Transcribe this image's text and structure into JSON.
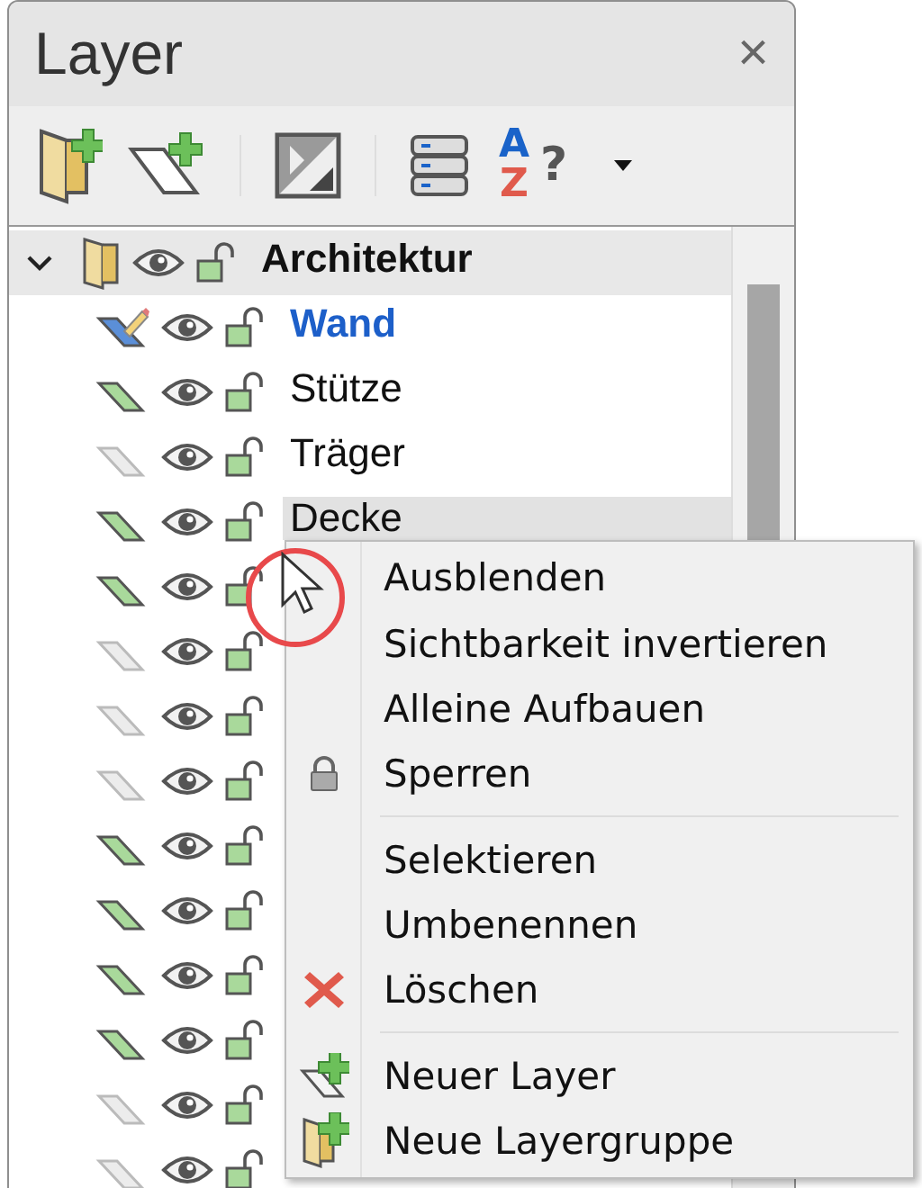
{
  "panel": {
    "title": "Layer",
    "close": "×"
  },
  "toolbar": {
    "sort_letters": [
      "A",
      "Z"
    ],
    "sort_mark": "?"
  },
  "groups": [
    {
      "name": "Architektur",
      "expanded": true,
      "layers": [
        {
          "name": "Wand",
          "color": "#5b8fd8",
          "selected": true
        },
        {
          "name": "Stütze",
          "color": "#a9d99b",
          "selected": false
        },
        {
          "name": "Träger",
          "color": "#ececec",
          "selected": false
        },
        {
          "name": "Decke",
          "color": "#a9d99b",
          "selected": false,
          "hovered": true
        },
        {
          "color": "#a9d99b",
          "selected": false
        },
        {
          "color": "#ececec",
          "selected": false
        },
        {
          "color": "#ececec",
          "selected": false
        },
        {
          "color": "#ececec",
          "selected": false
        },
        {
          "color": "#a9d99b",
          "selected": false
        },
        {
          "color": "#a9d99b",
          "selected": false
        },
        {
          "color": "#a9d99b",
          "selected": false
        },
        {
          "color": "#a9d99b",
          "selected": false
        },
        {
          "color": "#ececec",
          "selected": false
        },
        {
          "color": "#ececec",
          "selected": false
        }
      ]
    }
  ],
  "context_menu": {
    "items": [
      {
        "kind": "command",
        "label": "Ausblenden"
      },
      {
        "kind": "command",
        "label": "Sichtbarkeit invertieren"
      },
      {
        "kind": "command",
        "label": "Alleine Aufbauen"
      },
      {
        "kind": "lock",
        "label": "Sperren"
      },
      {
        "kind": "separator"
      },
      {
        "kind": "command",
        "label": "Selektieren"
      },
      {
        "kind": "command",
        "label": "Umbenennen"
      },
      {
        "kind": "delete",
        "label": "Löschen"
      },
      {
        "kind": "separator"
      },
      {
        "kind": "new-layer",
        "label": "Neuer Layer"
      },
      {
        "kind": "new-group",
        "label": "Neue Layergruppe"
      }
    ]
  }
}
